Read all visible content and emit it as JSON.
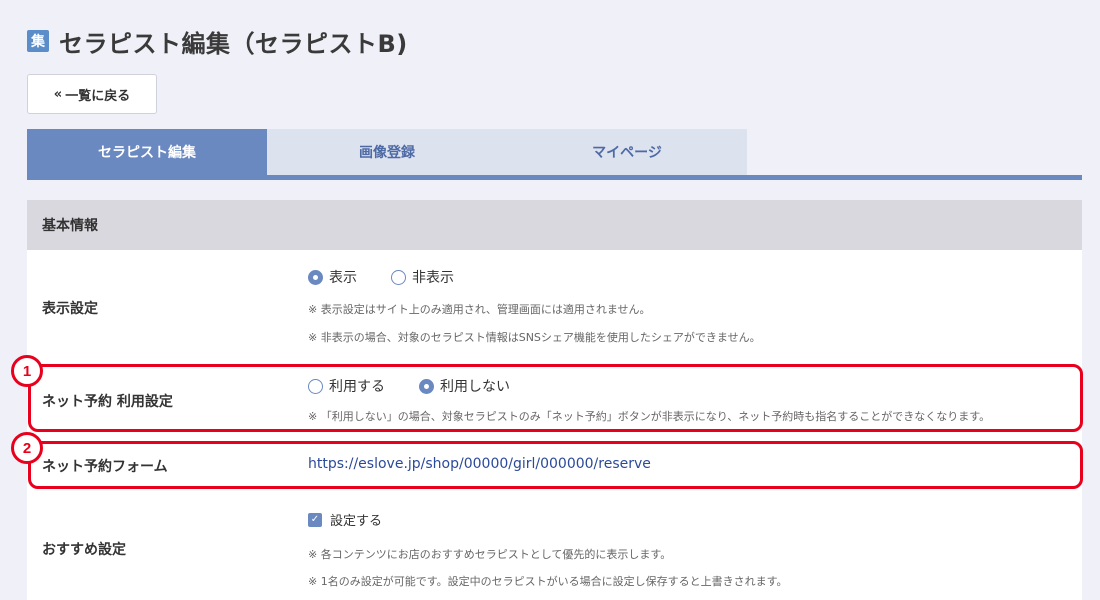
{
  "page": {
    "icon_char": "集",
    "title": "セラピスト編集（セラピストB)"
  },
  "back_button": {
    "chevron": "«",
    "label": "一覧に戻る"
  },
  "tabs": [
    {
      "label": "セラピスト編集",
      "active": true
    },
    {
      "label": "画像登録",
      "active": false
    },
    {
      "label": "マイページ",
      "active": false
    }
  ],
  "section": {
    "title": "基本情報"
  },
  "display_setting": {
    "label": "表示設定",
    "options": [
      {
        "label": "表示",
        "checked": true
      },
      {
        "label": "非表示",
        "checked": false
      }
    ],
    "notes": [
      "※ 表示設定はサイト上のみ適用され、管理画面には適用されません。",
      "※ 非表示の場合、対象のセラピスト情報はSNSシェア機能を使用したシェアができません。"
    ]
  },
  "net_reserve_setting": {
    "badge": "1",
    "label": "ネット予約 利用設定",
    "options": [
      {
        "label": "利用する",
        "checked": false
      },
      {
        "label": "利用しない",
        "checked": true
      }
    ],
    "note": "※ 「利用しない」の場合、対象セラピストのみ「ネット予約」ボタンが非表示になり、ネット予約時も指名することができなくなります。"
  },
  "net_reserve_form": {
    "badge": "2",
    "label": "ネット予約フォーム",
    "url": "https://eslove.jp/shop/00000/girl/000000/reserve"
  },
  "recommend_setting": {
    "label": "おすすめ設定",
    "checkbox_label": "設定する",
    "checked": true,
    "notes": [
      "※ 各コンテンツにお店のおすすめセラピストとして優先的に表示します。",
      "※ 1名のみ設定が可能です。設定中のセラピストがいる場合に設定し保存すると上書きされます。"
    ]
  },
  "colors": {
    "accent": "#6a89c1",
    "tab_inactive_bg": "#dde2ef",
    "highlight_red": "#e8001c",
    "link": "#2c4a9a"
  }
}
